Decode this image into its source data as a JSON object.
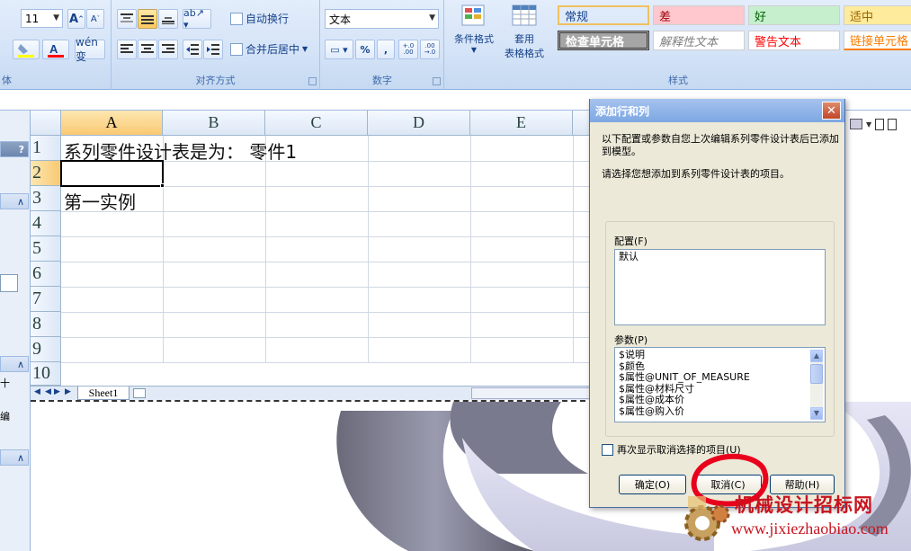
{
  "ribbon": {
    "font_size": "11",
    "wrap_text": "自动换行",
    "merge_center": "合并后居中",
    "align_group": "对齐方式",
    "font_group_tail": "体",
    "number_format": "文本",
    "number_group": "数字",
    "percent": "%",
    "comma": ",",
    "inc_decimal": "+.0 .00",
    "dec_decimal": ".00 →.0",
    "cond_format": "条件格式",
    "table_format_1": "套用",
    "table_format_2": "表格格式",
    "styles_group": "样式",
    "styles": [
      {
        "label": "常规",
        "color": "#000000",
        "bg": "#ffffff"
      },
      {
        "label": "差",
        "color": "#9c0006",
        "bg": "#ffc7ce"
      },
      {
        "label": "好",
        "color": "#006100",
        "bg": "#c6efce"
      },
      {
        "label": "适中",
        "color": "#9c6500",
        "bg": "#ffeb9c"
      },
      {
        "label": "检查单元格",
        "color": "#ffffff",
        "bg": "#a5a5a5"
      },
      {
        "label": "解释性文本",
        "color": "#7f7f7f",
        "bg": "#ffffff"
      },
      {
        "label": "警告文本",
        "color": "#ff0000",
        "bg": "#ffffff"
      },
      {
        "label": "链接单元格",
        "color": "#fa7d00",
        "bg": "#ffffff"
      }
    ]
  },
  "sheet": {
    "columns": [
      "A",
      "B",
      "C",
      "D",
      "E"
    ],
    "rows": [
      "1",
      "2",
      "3",
      "4",
      "5",
      "6",
      "7",
      "8",
      "9",
      "10"
    ],
    "a1": "系列零件设计表是为：  零件1",
    "a3": "第一实例",
    "tab": "Sheet1"
  },
  "left_panel": {
    "help": "?",
    "collapse": "∧",
    "frag1": "十",
    "frag2": "编"
  },
  "dialog": {
    "title": "添加行和列",
    "close": "✕",
    "intro": "以下配置或参数自您上次编辑系列零件设计表后已添加到模型。",
    "prompt": "请选择您想添加到系列零件设计表的项目。",
    "config_label": "配置(F)",
    "config_items": [
      "默认"
    ],
    "param_label": "参数(P)",
    "param_items": [
      "$说明",
      "$颜色",
      "$属性@UNIT_OF_MEASURE",
      "$属性@材料尺寸",
      "$属性@成本价",
      "$属性@购入价"
    ],
    "checkbox_label": "再次显示取消选择的项目(U)",
    "ok": "确定(O)",
    "cancel": "取消(C)",
    "help": "帮助(H)"
  },
  "watermark": {
    "name": "机械设计招标网",
    "url": "www.jixiezhaobiao.com"
  },
  "colors": {
    "annotation": "#e8001c",
    "ribbon_bg": "#d4e3f7",
    "dialog_bg": "#ece9d8"
  }
}
